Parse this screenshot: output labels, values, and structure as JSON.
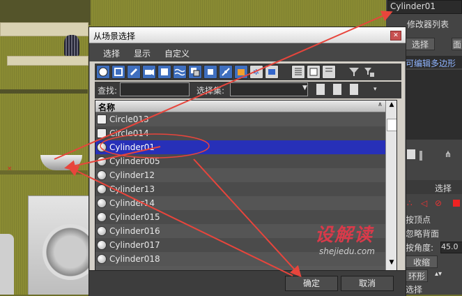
{
  "dialog": {
    "title": "从场景选择",
    "menus": [
      "选择",
      "显示",
      "自定义"
    ],
    "find_label": "查找:",
    "find_value": "",
    "selection_set_label": "选择集:",
    "selection_set_value": "",
    "list_header": "名称",
    "items": [
      {
        "name": "Circle013",
        "icon": "shape-icon",
        "selected": false
      },
      {
        "name": "Circle014",
        "icon": "shape-icon",
        "selected": false
      },
      {
        "name": "Cylinder01",
        "icon": "geometry-icon",
        "selected": true
      },
      {
        "name": "Cylinder005",
        "icon": "geometry-icon",
        "selected": false
      },
      {
        "name": "Cylinder12",
        "icon": "geometry-icon",
        "selected": false
      },
      {
        "name": "Cylinder13",
        "icon": "geometry-icon",
        "selected": false
      },
      {
        "name": "Cylinder14",
        "icon": "geometry-icon",
        "selected": false
      },
      {
        "name": "Cylinder015",
        "icon": "geometry-icon",
        "selected": false
      },
      {
        "name": "Cylinder016",
        "icon": "geometry-icon",
        "selected": false
      },
      {
        "name": "Cylinder017",
        "icon": "geometry-icon",
        "selected": false
      },
      {
        "name": "Cylinder018",
        "icon": "geometry-icon",
        "selected": false
      }
    ],
    "ok_label": "确定",
    "cancel_label": "取消",
    "close_glyph": "✕"
  },
  "command_panel": {
    "object_name": "Cylinder01",
    "modifier_list_label": "修改器列表",
    "buttons": [
      "选择",
      "面"
    ],
    "stack_item": "可编辑多边形",
    "selection_rollout": "选择",
    "by_vertex": "按顶点",
    "ignore_backfacing": "忽略背面",
    "by_angle_label": "按角度:",
    "by_angle_value": "45.0",
    "shrink": "收缩",
    "ring": "环形",
    "select_label": "选择"
  },
  "watermark": {
    "main": "设解读",
    "sub": "shejiedu.com"
  },
  "colors": {
    "selection": "#2730b8",
    "annotation": "#e8453c",
    "watermark": "#d83a4a"
  }
}
